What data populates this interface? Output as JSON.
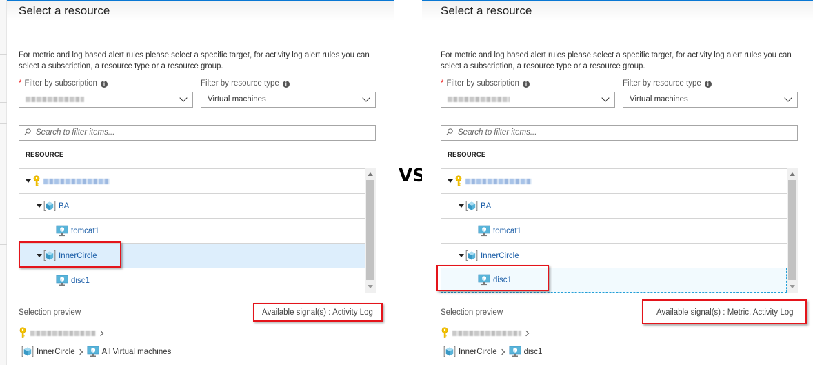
{
  "vs_label": "VS",
  "panels": [
    {
      "title": "Select a resource",
      "description": "For metric and log based alert rules please select a specific target, for activity log alert rules you can select a subscription, a resource type or a resource group.",
      "subscription_filter": {
        "label": "Filter by subscription",
        "required_mark": "*",
        "value": "(redacted subscription)"
      },
      "resource_type_filter": {
        "label": "Filter by resource type",
        "value": "Virtual machines"
      },
      "search": {
        "placeholder": "Search to filter items..."
      },
      "column_header": "RESOURCE",
      "tree": [
        {
          "level": 0,
          "type": "subscription",
          "icon": "key-icon",
          "label": "(redacted subscription)",
          "expanded": true
        },
        {
          "level": 1,
          "type": "resource-group",
          "icon": "resource-group-icon",
          "label": "BA",
          "expanded": true
        },
        {
          "level": 2,
          "type": "virtual-machine",
          "icon": "virtual-machine-icon",
          "label": "tomcat1"
        },
        {
          "level": 1,
          "type": "resource-group",
          "icon": "resource-group-icon",
          "label": "InnerCircle",
          "expanded": true,
          "selected": true,
          "highlighted": true
        },
        {
          "level": 2,
          "type": "virtual-machine",
          "icon": "virtual-machine-icon",
          "label": "disc1"
        }
      ],
      "selection_preview": {
        "label": "Selection preview",
        "available_signals": "Available signal(s) : Activity Log",
        "path_subscription": "(redacted subscription)",
        "path_group": "InnerCircle",
        "path_target": "All Virtual machines"
      }
    },
    {
      "title": "Select a resource",
      "description": "For metric and log based alert rules please select a specific target, for activity log alert rules you can select a subscription, a resource type or a resource group.",
      "subscription_filter": {
        "label": "Filter by subscription",
        "required_mark": "*",
        "value": "(redacted subscription)"
      },
      "resource_type_filter": {
        "label": "Filter by resource type",
        "value": "Virtual machines"
      },
      "search": {
        "placeholder": "Search to filter items..."
      },
      "column_header": "RESOURCE",
      "tree": [
        {
          "level": 0,
          "type": "subscription",
          "icon": "key-icon",
          "label": "(redacted subscription)",
          "expanded": true
        },
        {
          "level": 1,
          "type": "resource-group",
          "icon": "resource-group-icon",
          "label": "BA",
          "expanded": true
        },
        {
          "level": 2,
          "type": "virtual-machine",
          "icon": "virtual-machine-icon",
          "label": "tomcat1"
        },
        {
          "level": 1,
          "type": "resource-group",
          "icon": "resource-group-icon",
          "label": "InnerCircle",
          "expanded": true
        },
        {
          "level": 2,
          "type": "virtual-machine",
          "icon": "virtual-machine-icon",
          "label": "disc1",
          "selected": true,
          "focused": true,
          "highlighted": true
        }
      ],
      "selection_preview": {
        "label": "Selection preview",
        "available_signals": "Available signal(s) : Metric, Activity Log",
        "path_subscription": "(redacted subscription)",
        "path_group": "InnerCircle",
        "path_target": "disc1"
      }
    }
  ],
  "colors": {
    "accent_bar": "#0a78d4",
    "link_text": "#1d5fa8",
    "selected_row": "#ddeefc",
    "focused_row_border": "#24a0d8",
    "highlight_box": "#e4141b",
    "required_star": "#ee0000"
  }
}
